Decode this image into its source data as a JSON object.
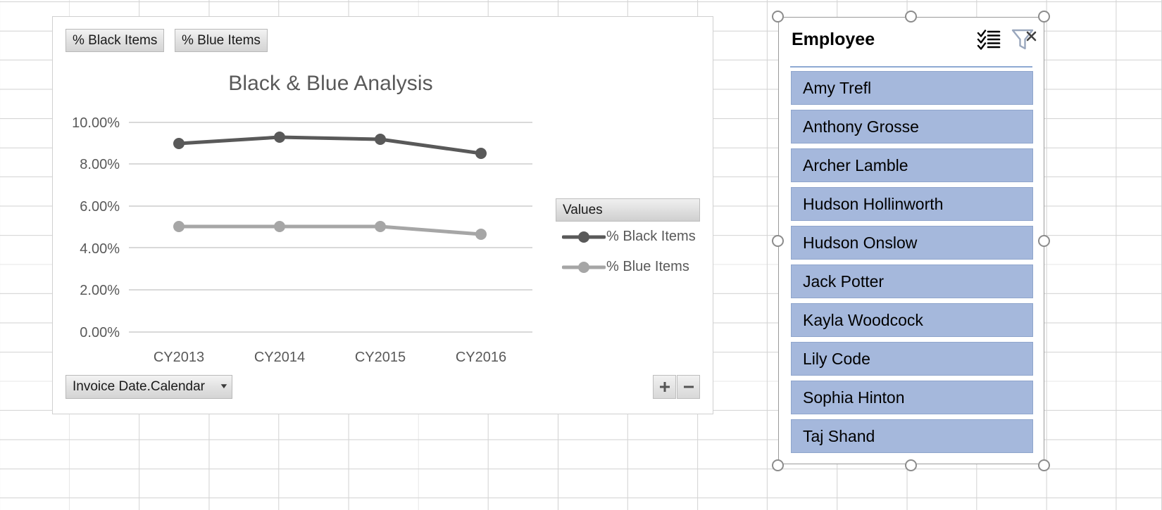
{
  "chart": {
    "title": "Black & Blue Analysis",
    "legend_title": "Values",
    "field_buttons": {
      "black_items": "% Black Items",
      "blue_items": "% Blue Items",
      "axis_field": "Invoice Date.Calendar",
      "axis_caret": "▼"
    },
    "drill": {
      "expand": "+",
      "collapse": "−"
    },
    "colors": {
      "black_series": "#595959",
      "blue_series": "#a6a6a6",
      "gridline": "#d9d9d9",
      "text": "#595959"
    }
  },
  "chart_data": {
    "type": "line",
    "title": "Black & Blue Analysis",
    "xlabel": "",
    "ylabel": "",
    "categories": [
      "CY2013",
      "CY2014",
      "CY2015",
      "CY2016"
    ],
    "ytick_labels": [
      "0.00%",
      "2.00%",
      "4.00%",
      "6.00%",
      "8.00%",
      "10.00%"
    ],
    "ytick_values": [
      0,
      2,
      4,
      6,
      8,
      10
    ],
    "ylim": [
      0,
      10
    ],
    "grid": true,
    "legend_position": "right",
    "legend_title": "Values",
    "series": [
      {
        "name": "% Black Items",
        "color": "#595959",
        "values": [
          9.0,
          9.3,
          9.2,
          8.5
        ]
      },
      {
        "name": "% Blue Items",
        "color": "#a6a6a6",
        "values": [
          5.05,
          5.05,
          5.05,
          4.7
        ]
      }
    ]
  },
  "slicer": {
    "title": "Employee",
    "multiselect_icon": "multi-select-icon",
    "clearfilter_icon": "clear-filter-icon",
    "items": [
      "Amy Trefl",
      "Anthony Grosse",
      "Archer Lamble",
      "Hudson Hollinworth",
      "Hudson Onslow",
      "Jack Potter",
      "Kayla Woodcock",
      "Lily Code",
      "Sophia Hinton",
      "Taj Shand"
    ]
  }
}
